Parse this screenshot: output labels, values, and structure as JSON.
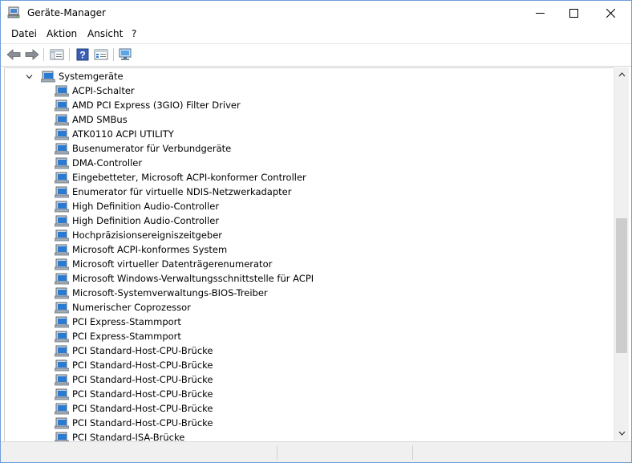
{
  "window": {
    "title": "Geräte-Manager"
  },
  "menu": [
    "Datei",
    "Aktion",
    "Ansicht",
    "?"
  ],
  "tree": {
    "category": "Systemgeräte",
    "devices": [
      "ACPI-Schalter",
      "AMD PCI Express (3GIO) Filter Driver",
      "AMD SMBus",
      "ATK0110 ACPI UTILITY",
      "Busenumerator für Verbundgeräte",
      "DMA-Controller",
      "Eingebetteter, Microsoft ACPI-konformer Controller",
      "Enumerator für virtuelle NDIS-Netzwerkadapter",
      "High Definition Audio-Controller",
      "High Definition Audio-Controller",
      "Hochpräzisionsereigniszeitgeber",
      "Microsoft ACPI-konformes System",
      "Microsoft virtueller Datenträgerenumerator",
      "Microsoft Windows-Verwaltungsschnittstelle für ACPI",
      "Microsoft-Systemverwaltungs-BIOS-Treiber",
      "Numerischer Coprozessor",
      "PCI Express-Stammport",
      "PCI Express-Stammport",
      "PCI Standard-Host-CPU-Brücke",
      "PCI Standard-Host-CPU-Brücke",
      "PCI Standard-Host-CPU-Brücke",
      "PCI Standard-Host-CPU-Brücke",
      "PCI Standard-Host-CPU-Brücke",
      "PCI Standard-Host-CPU-Brücke",
      "PCI Standard-ISA-Brücke"
    ]
  },
  "toolbar_icons": [
    "back-arrow-icon",
    "forward-arrow-icon",
    "show-hide-console-tree-icon",
    "help-icon",
    "properties-icon",
    "scan-hardware-icon"
  ],
  "colors": {
    "window_border": "#6f9fd8",
    "icon_blue": "#2a7ad2",
    "scroll_thumb": "#cdcdcd"
  }
}
